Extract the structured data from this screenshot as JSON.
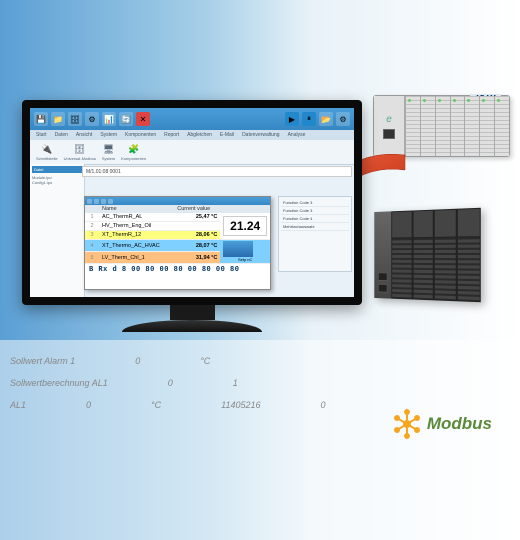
{
  "background_rows": [
    [
      "Sollwert Alarm 1",
      "0",
      "°C"
    ],
    [
      "Sollwertberechnung AL1",
      "0",
      "1"
    ],
    [
      "AL1",
      "0",
      "°C",
      "11405216",
      "0"
    ]
  ],
  "hardware": {
    "top_unit_label": "ADAM"
  },
  "modbus_logo_text": "Modbus",
  "app": {
    "tabs": [
      "Start",
      "Daten",
      "Ansicht",
      "System",
      "Komponenten",
      "Report",
      "Abgleichen",
      "E-Mail",
      "Datenverwaltung",
      "Analyse"
    ],
    "sub_tools": [
      {
        "glyph": "🔧",
        "label": "Schnittstelle"
      },
      {
        "glyph": "🌐",
        "label": "Universal-Modbus"
      },
      {
        "glyph": "⚙",
        "label": "System"
      },
      {
        "glyph": "🧩",
        "label": "Komponenten"
      }
    ],
    "left_panel_header": "Datei",
    "left_items": [
      "Module.ipo",
      "Config1.ipo"
    ],
    "address_bar": "M/1.01:08 0001",
    "table": {
      "headers": [
        "",
        "Name",
        "Current value"
      ],
      "rows": [
        {
          "idx": "1",
          "name": "AC_ThermR_AL",
          "val": "25,47 °C",
          "bg": "#ffffff"
        },
        {
          "idx": "2",
          "name": "HV_Therm_Eng_Oil",
          "val": "",
          "bg": "#ffffff"
        },
        {
          "idx": "3",
          "name": "XT_ThermR_12",
          "val": "28,06 °C",
          "bg": "#ffff80"
        },
        {
          "idx": "4",
          "name": "XT_Thermo_AC_HVAC",
          "val": "28,07 °C",
          "bg": "#80d0ff"
        },
        {
          "idx": "5",
          "name": "LV_Therm_Chl_1",
          "val": "31,94 °C",
          "bg": "#ffc080"
        }
      ],
      "big_value": "21.24",
      "footer_label": "Setp nC"
    },
    "side_panel": {
      "items": [
        "Function Code 3",
        "Function Code 3",
        "Function Code 4",
        "Mehrfachauswahl"
      ]
    },
    "hex_line": "B Rx d 8 00 80 00 80 00 80 00 80"
  }
}
